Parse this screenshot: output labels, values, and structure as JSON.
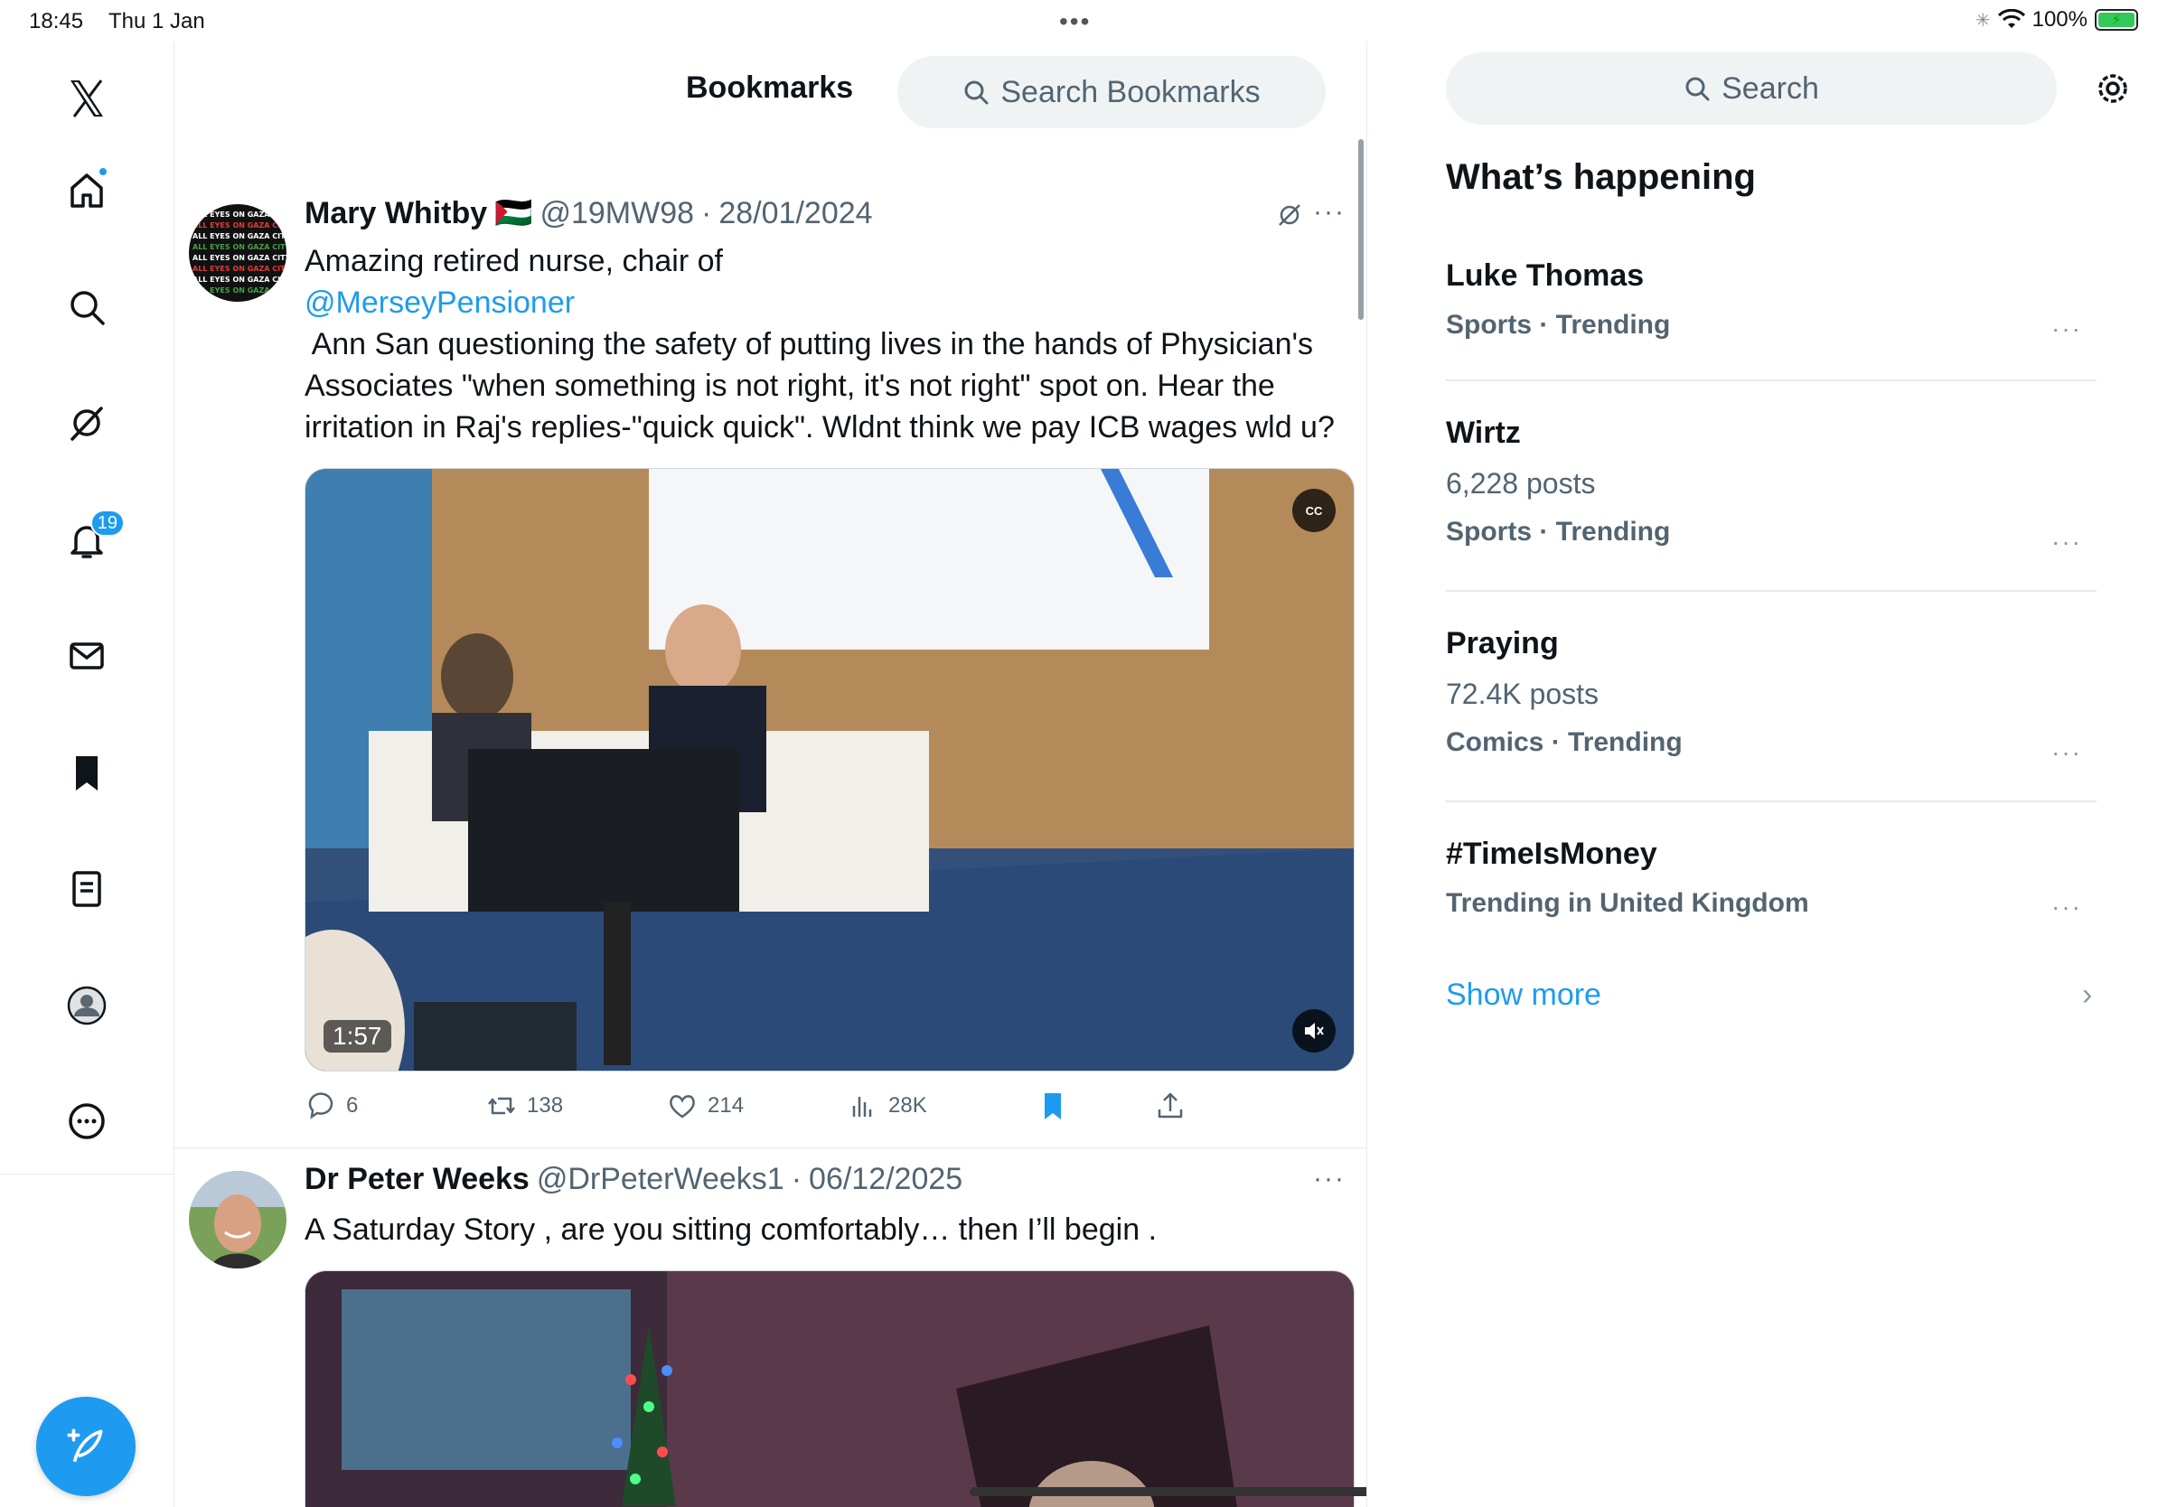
{
  "status_bar": {
    "time": "18:45",
    "date": "Thu 1 Jan",
    "battery": "100%",
    "battery_level": 1.0
  },
  "nav": {
    "notifications_badge": "19",
    "items": [
      "home",
      "explore",
      "grok",
      "notifications",
      "messages",
      "bookmarks",
      "lists",
      "profile",
      "more"
    ],
    "active": "bookmarks"
  },
  "header": {
    "title": "Bookmarks",
    "search_placeholder": "Search Bookmarks"
  },
  "tweets": [
    {
      "author": "Mary Whitby",
      "flag": "🇵🇸",
      "handle": "@19MW98",
      "separator": "·",
      "date": "28/01/2024",
      "text_lines": [
        "Amazing retired nurse, chair of",
        "@MerseyPensioner",
        " Ann San questioning the safety of putting lives in the hands of Physician's",
        "Associates \"when something is not right, it's not right\" spot on. Hear the",
        "irritation in Raj's replies-\"quick quick\". Wldnt think we pay ICB wages wld u?"
      ],
      "video_duration": "1:57",
      "cc_label": "CC",
      "replies": "6",
      "reposts": "138",
      "likes": "214",
      "views": "28K",
      "bookmarked": true
    },
    {
      "author": "Dr Peter Weeks",
      "handle": "@DrPeterWeeks1",
      "separator": "·",
      "date": "06/12/2025",
      "text": "A Saturday Story , are you sitting comfortably… then I’ll begin ."
    }
  ],
  "sidebar": {
    "search_placeholder": "Search",
    "title": "What’s happening",
    "trends": [
      {
        "name": "Luke Thomas",
        "count": "",
        "meta": "Sports · Trending"
      },
      {
        "name": "Wirtz",
        "count": "6,228 posts",
        "meta": "Sports · Trending"
      },
      {
        "name": "Praying",
        "count": "72.4K posts",
        "meta": "Comics · Trending"
      },
      {
        "name": "#TimeIsMoney",
        "count": "",
        "meta": "Trending in United Kingdom"
      }
    ],
    "more_dots": "···",
    "show_more": "Show more"
  },
  "colors": {
    "accent": "#1d9bf0",
    "muted": "#536471",
    "divider": "#e6e9eb"
  }
}
